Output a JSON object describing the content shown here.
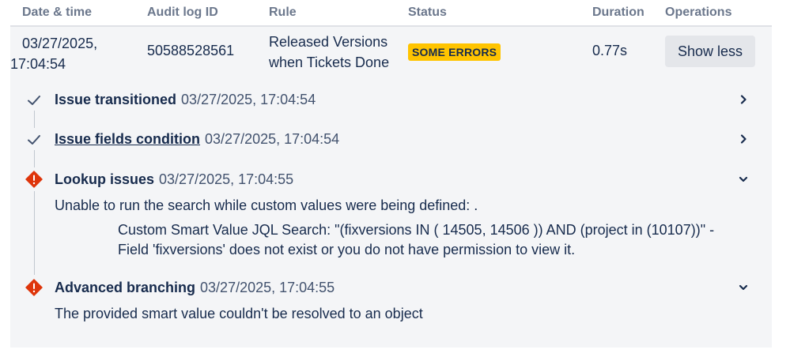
{
  "columns": {
    "date_time": "Date & time",
    "audit_log_id": "Audit log ID",
    "rule": "Rule",
    "status": "Status",
    "duration": "Duration",
    "operations": "Operations"
  },
  "row": {
    "date_line1": "03/27/2025,",
    "date_line2": "17:04:54",
    "audit_log_id": "50588528561",
    "rule_line1": "Released Versions",
    "rule_line2": "when Tickets Done",
    "status": "SOME ERRORS",
    "duration": "0.77s",
    "show_less_label": "Show less"
  },
  "steps": [
    {
      "name": "Issue transitioned",
      "timestamp": "03/27/2025, 17:04:54",
      "icon": "check-icon",
      "expanded": false
    },
    {
      "name": "Issue fields condition",
      "timestamp": "03/27/2025, 17:04:54",
      "icon": "check-icon",
      "expanded": false
    },
    {
      "name": "Lookup issues",
      "timestamp": "03/27/2025, 17:04:55",
      "icon": "error-icon",
      "expanded": true,
      "message": "Unable to run the search while custom values were being defined: .",
      "detail_line1": "Custom Smart Value JQL Search: \"(fixversions IN ( 14505, 14506 )) AND (project in (10107))\" -",
      "detail_line2": "Field 'fixversions' does not exist or you do not have permission to view it."
    },
    {
      "name": "Advanced branching",
      "timestamp": "03/27/2025, 17:04:55",
      "icon": "error-icon",
      "expanded": true,
      "message": "The provided smart value couldn't be resolved to an object"
    }
  ],
  "colors": {
    "status_badge": "#ffc400",
    "error": "#de350b",
    "check": "#42526e",
    "panel": "#f4f5f7"
  }
}
